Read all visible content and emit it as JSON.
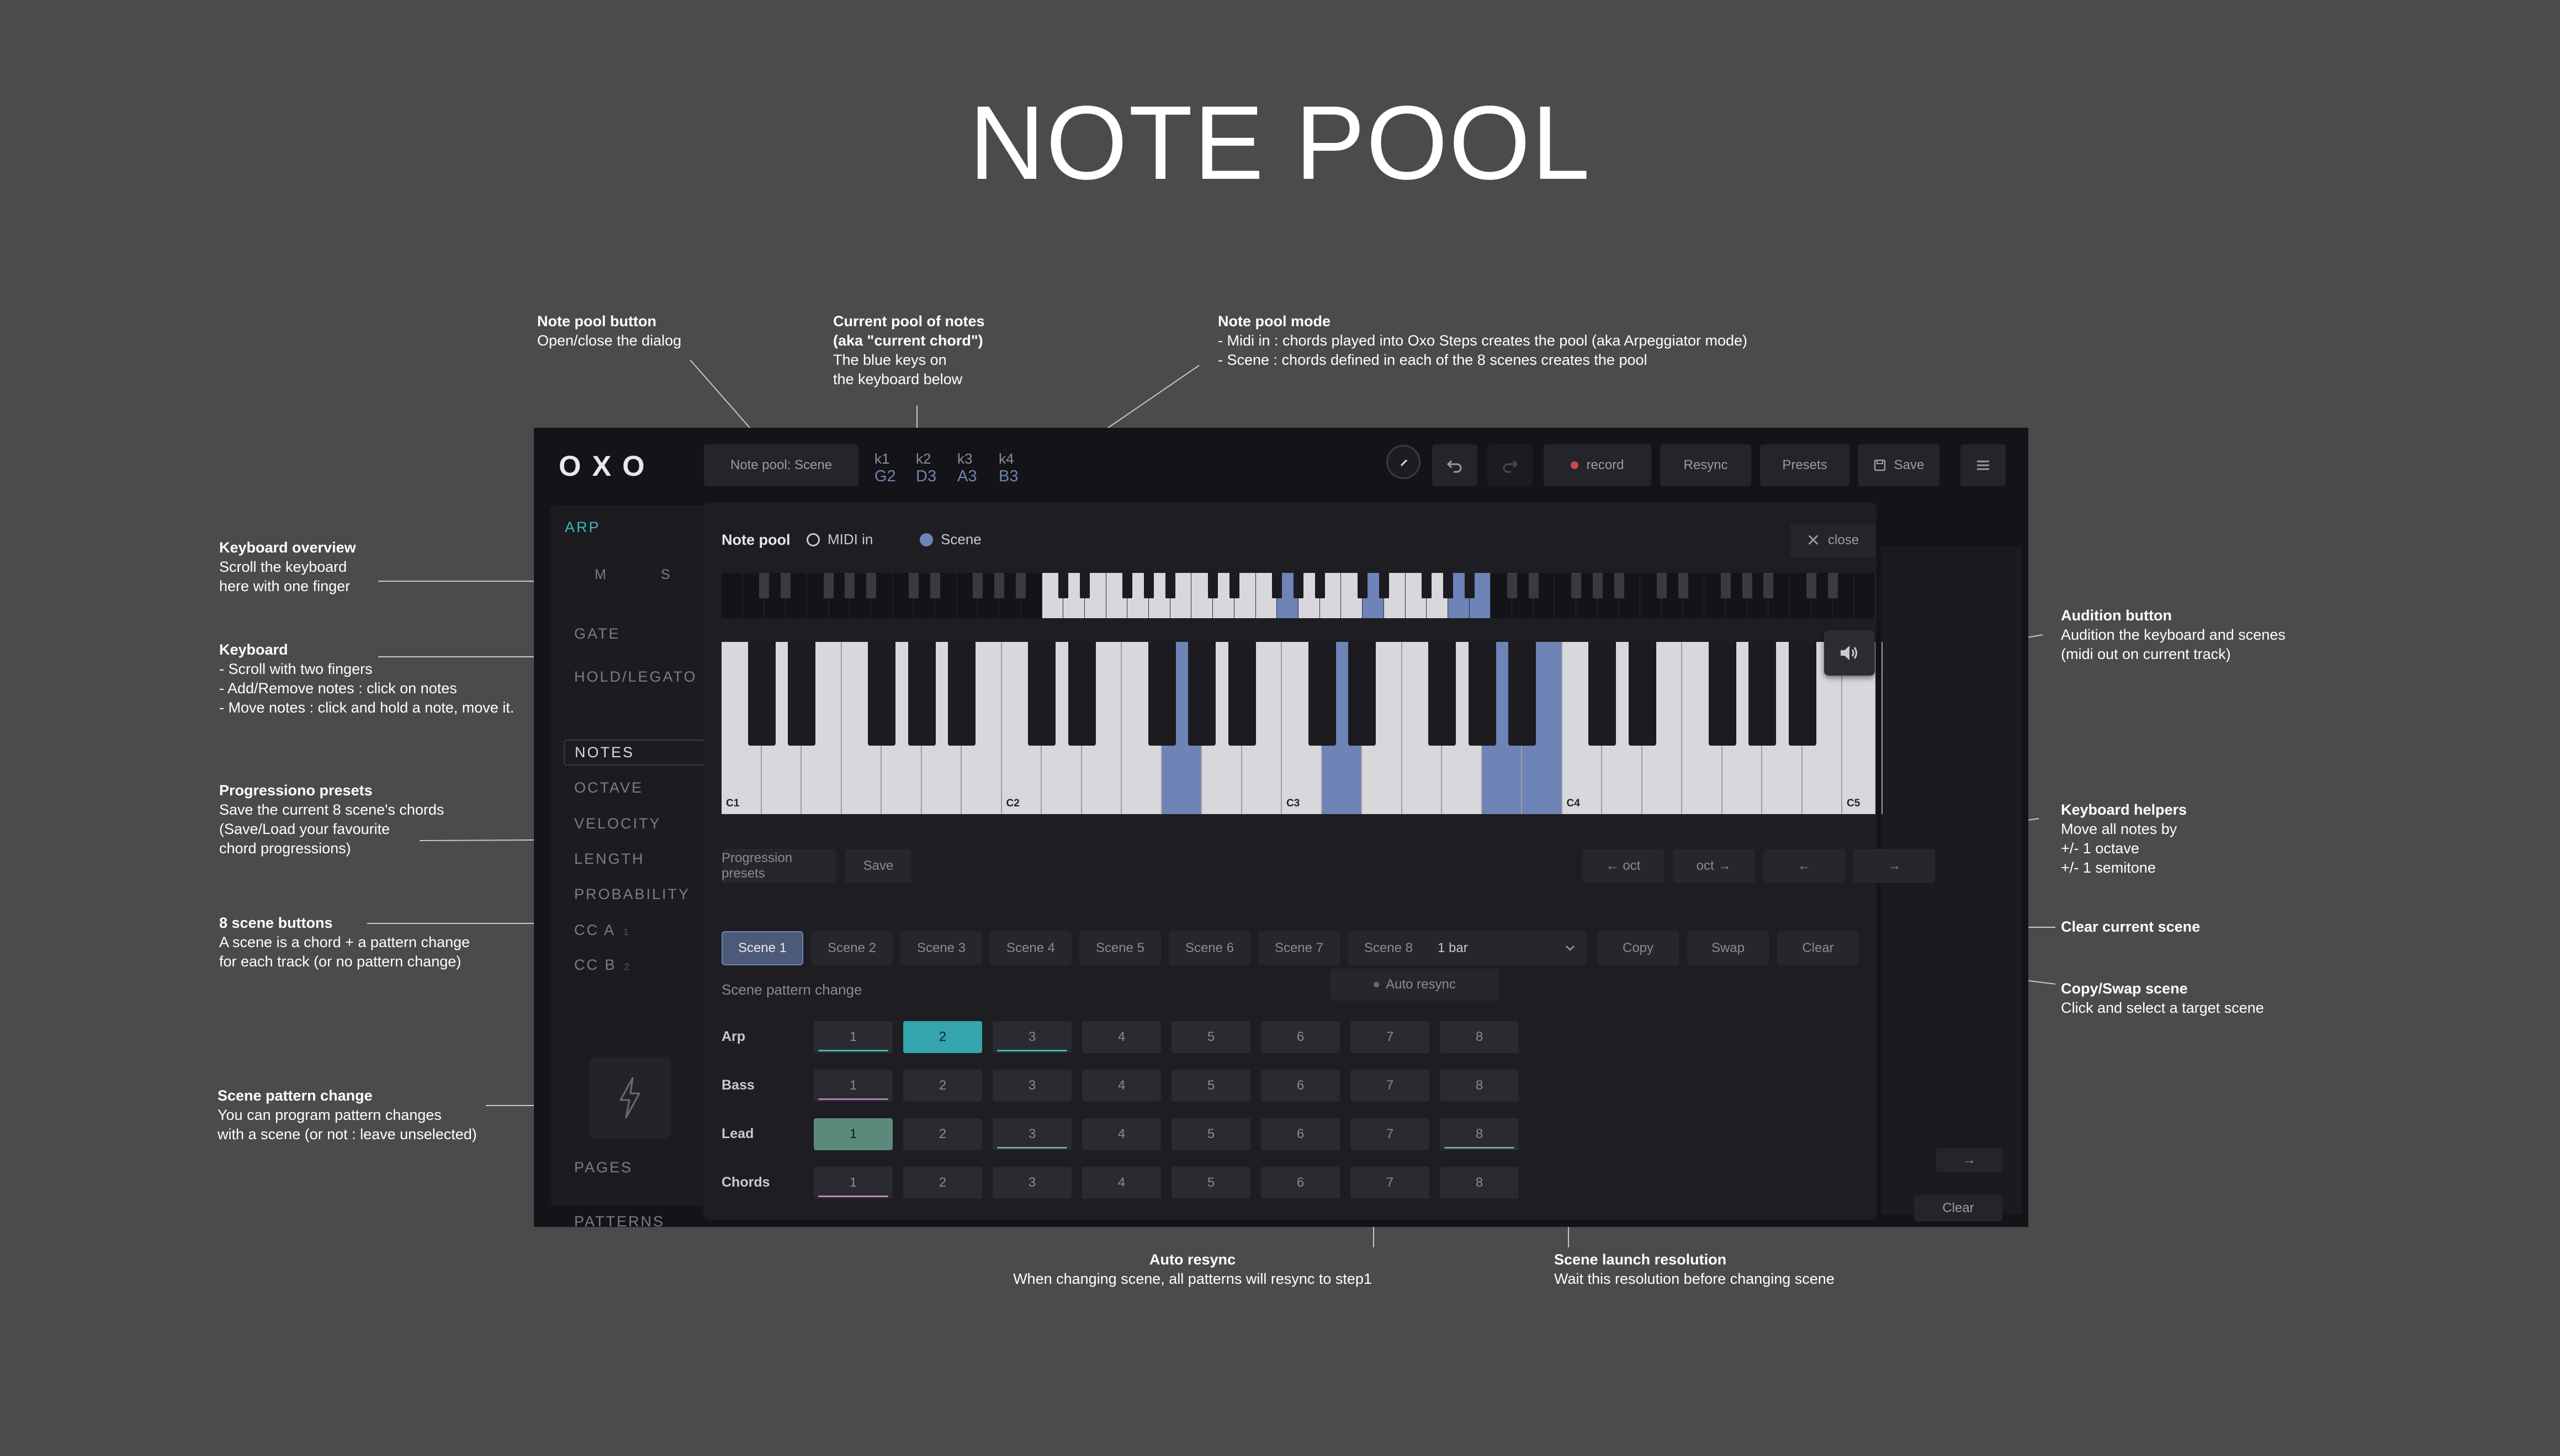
{
  "page_title": "NOTE POOL",
  "annotations": {
    "note_pool_button": {
      "heading": "Note pool button",
      "lines": [
        "Open/close the dialog"
      ]
    },
    "current_pool": {
      "heading": "Current pool of notes\n(aka \"current chord\")",
      "lines": [
        "The blue keys on",
        "the keyboard below"
      ]
    },
    "note_pool_mode": {
      "heading": "Note pool mode",
      "lines": [
        "- Midi in : chords played into Oxo Steps creates the pool (aka Arpeggiator mode)",
        "- Scene : chords defined in each of the 8 scenes creates the pool"
      ]
    },
    "keyboard_overview": {
      "heading": "Keyboard overview",
      "lines": [
        "Scroll the keyboard",
        "here with one finger"
      ]
    },
    "keyboard": {
      "heading": "Keyboard",
      "lines": [
        "- Scroll with two fingers",
        "- Add/Remove notes : click on notes",
        "- Move notes : click and hold a note, move it."
      ]
    },
    "progression_presets": {
      "heading": "Progressiono presets",
      "lines": [
        "Save the current 8 scene's chords",
        "(Save/Load your favourite",
        "chord progressions)"
      ]
    },
    "scene_buttons": {
      "heading": "8 scene buttons",
      "lines": [
        "A scene is a chord + a pattern change",
        "for each track (or no pattern change)"
      ]
    },
    "scene_pattern_change": {
      "heading": "Scene pattern change",
      "lines": [
        "You can program pattern changes",
        "with a scene (or not : leave unselected)"
      ]
    },
    "audition_button": {
      "heading": "Audition button",
      "lines": [
        "Audition the keyboard and scenes",
        "(midi out on current track)"
      ]
    },
    "keyboard_helpers": {
      "heading": "Keyboard helpers",
      "lines": [
        "Move all notes by",
        "+/- 1 octave",
        "+/- 1 semitone"
      ]
    },
    "clear_scene": {
      "heading": "Clear current scene",
      "lines": []
    },
    "copy_swap": {
      "heading": "Copy/Swap scene",
      "lines": [
        "Click and select a target scene"
      ]
    },
    "auto_resync": {
      "heading": "Auto resync",
      "lines": [
        "When changing scene, all patterns will resync to step1"
      ]
    },
    "launch_resolution": {
      "heading": "Scene launch resolution",
      "lines": [
        "Wait this resolution before changing scene"
      ]
    }
  },
  "app": {
    "logo": "OXO",
    "note_pool_button": "Note pool: Scene",
    "chord": [
      {
        "k": "k1",
        "note": "G2"
      },
      {
        "k": "k2",
        "note": "D3"
      },
      {
        "k": "k3",
        "note": "A3"
      },
      {
        "k": "k4",
        "note": "B3"
      }
    ],
    "toolbar": {
      "record": "record",
      "resync": "Resync",
      "presets": "Presets",
      "save": "Save"
    },
    "sidebar": {
      "arp": "ARP",
      "m": "M",
      "s": "S",
      "items": [
        "GATE",
        "HOLD/LEGATO",
        "NOTES",
        "OCTAVE",
        "VELOCITY",
        "LENGTH",
        "PROBABILITY",
        "CC A",
        "CC B"
      ],
      "cc_a_sub": "1",
      "cc_b_sub": "2",
      "pages": "PAGES",
      "patterns": "PATTERNS"
    },
    "right_panel": {
      "clear": "Clear"
    },
    "dialog": {
      "title": "Note pool",
      "mode_midi": "MIDI in",
      "mode_scene": "Scene",
      "mode_selected": "Scene",
      "close": "close",
      "octave_labels": [
        "C1",
        "C2",
        "C3",
        "C4",
        "C5"
      ],
      "selected_keys": [
        "G2",
        "D3",
        "A3",
        "B3"
      ],
      "progression_presets": "Progression presets",
      "save": "Save",
      "oct_down": "← oct",
      "oct_up": "oct →",
      "semi_down": "←",
      "semi_up": "→",
      "scenes": [
        "Scene 1",
        "Scene 2",
        "Scene 3",
        "Scene 4",
        "Scene 5",
        "Scene 6",
        "Scene 7",
        "Scene 8"
      ],
      "active_scene": "Scene 1",
      "resolution": "1 bar",
      "copy": "Copy",
      "swap": "Swap",
      "clear": "Clear",
      "scene_pattern_change": "Scene pattern change",
      "auto_resync": "Auto resync",
      "tracks": [
        {
          "name": "Arp",
          "selected": 2,
          "color": "#3fb6bd",
          "underlined": [
            1,
            3
          ]
        },
        {
          "name": "Bass",
          "selected": 0,
          "color": "#b07ab8",
          "underlined": [
            1
          ]
        },
        {
          "name": "Lead",
          "selected": 1,
          "color": "#6fa894",
          "underlined": [
            3,
            8
          ]
        },
        {
          "name": "Chords",
          "selected": 0,
          "color": "#c087b8",
          "underlined": [
            1
          ]
        }
      ],
      "pattern_numbers": [
        "1",
        "2",
        "3",
        "4",
        "5",
        "6",
        "7",
        "8"
      ]
    }
  },
  "colors": {
    "background": "#4b4b4b",
    "accent_teal": "#3fb6bd",
    "key_blue": "#6e83b6",
    "app_bg": "#141418"
  }
}
